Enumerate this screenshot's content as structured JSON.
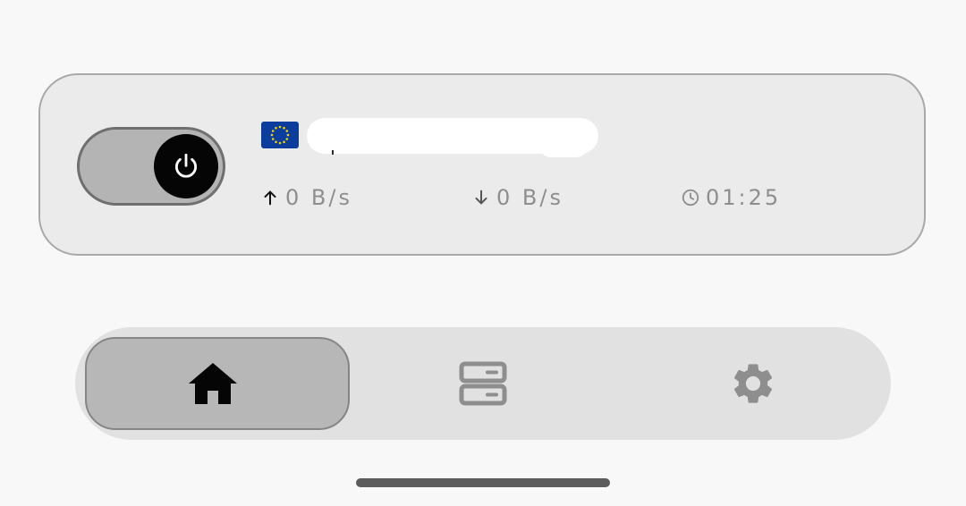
{
  "connection": {
    "connected": true,
    "server_flag": "eu-flag-icon",
    "server_name": "",
    "upload_speed": "0 B/s",
    "download_speed": "0 B/s",
    "elapsed_time": "01:25"
  },
  "navigation": {
    "items": [
      {
        "id": "home",
        "icon": "home-icon",
        "selected": true
      },
      {
        "id": "servers",
        "icon": "server-icon",
        "selected": false
      },
      {
        "id": "settings",
        "icon": "gear-icon",
        "selected": false
      }
    ]
  },
  "colors": {
    "background": "#f8f8f8",
    "card": "#ebebeb",
    "card_border": "#a9a9a9",
    "toggle_track": "#b4b4b4",
    "toggle_knob": "#050505",
    "nav_bar": "#e1e1e1",
    "nav_selected": "#b7b7b7",
    "muted_text": "#8e8e8e",
    "eu_blue": "#0b3e9c",
    "eu_gold": "#f5d300"
  }
}
